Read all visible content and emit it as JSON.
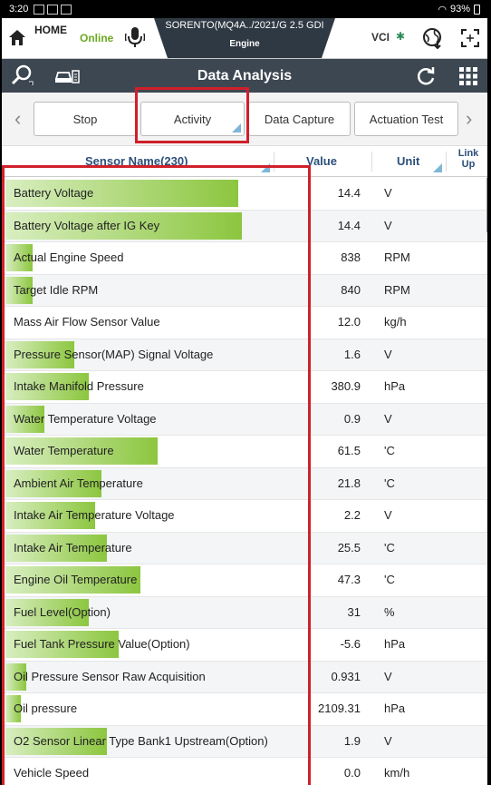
{
  "status_bar": {
    "time": "3:20",
    "battery": "93%"
  },
  "header": {
    "home": "HOME",
    "home_sub": "",
    "connection": "Online",
    "vehicle": "SORENTO(MQ4A../2021/G 2.5 GDI",
    "system": "Engine",
    "vci": "VCI"
  },
  "title_bar": {
    "title": "Data Analysis"
  },
  "toolbar": {
    "stop": "Stop",
    "activity": "Activity",
    "data_capture": "Data Capture",
    "actuation_test": "Actuation Test"
  },
  "table": {
    "col_sensor": "Sensor Name(230)",
    "col_value": "Value",
    "col_unit": "Unit",
    "col_link": "Link Up",
    "rows": [
      {
        "name": "Battery Voltage",
        "value": "14.4",
        "unit": "V",
        "bar": 0.78
      },
      {
        "name": "Battery Voltage after IG Key",
        "value": "14.4",
        "unit": "V",
        "bar": 0.79
      },
      {
        "name": "Actual Engine Speed",
        "value": "838",
        "unit": "RPM",
        "bar": 0.09
      },
      {
        "name": "Target Idle RPM",
        "value": "840",
        "unit": "RPM",
        "bar": 0.09
      },
      {
        "name": "Mass Air Flow Sensor Value",
        "value": "12.0",
        "unit": "kg/h",
        "bar": 0.0
      },
      {
        "name": "Pressure Sensor(MAP) Signal Voltage",
        "value": "1.6",
        "unit": "V",
        "bar": 0.23
      },
      {
        "name": "Intake Manifold Pressure",
        "value": "380.9",
        "unit": "hPa",
        "bar": 0.28
      },
      {
        "name": "Water Temperature Voltage",
        "value": "0.9",
        "unit": "V",
        "bar": 0.13
      },
      {
        "name": "Water Temperature",
        "value": "61.5",
        "unit": "'C",
        "bar": 0.51
      },
      {
        "name": "Ambient Air Temperature",
        "value": "21.8",
        "unit": "'C",
        "bar": 0.32
      },
      {
        "name": "Intake Air Temperature Voltage",
        "value": "2.2",
        "unit": "V",
        "bar": 0.3
      },
      {
        "name": "Intake Air Temperature",
        "value": "25.5",
        "unit": "'C",
        "bar": 0.34
      },
      {
        "name": "Engine Oil Temperature",
        "value": "47.3",
        "unit": "'C",
        "bar": 0.45
      },
      {
        "name": "Fuel Level(Option)",
        "value": "31",
        "unit": "%",
        "bar": 0.28
      },
      {
        "name": "Fuel Tank Pressure Value(Option)",
        "value": "-5.6",
        "unit": "hPa",
        "bar": 0.38
      },
      {
        "name": "Oil Pressure Sensor Raw Acquisition",
        "value": "0.931",
        "unit": "V",
        "bar": 0.07
      },
      {
        "name": "Oil pressure",
        "value": "2109.31",
        "unit": "hPa",
        "bar": 0.05
      },
      {
        "name": "O2 Sensor Linear Type Bank1 Upstream(Option)",
        "value": "1.9",
        "unit": "V",
        "bar": 0.34
      },
      {
        "name": "Vehicle Speed",
        "value": "0.0",
        "unit": "km/h",
        "bar": 0.0
      }
    ]
  }
}
